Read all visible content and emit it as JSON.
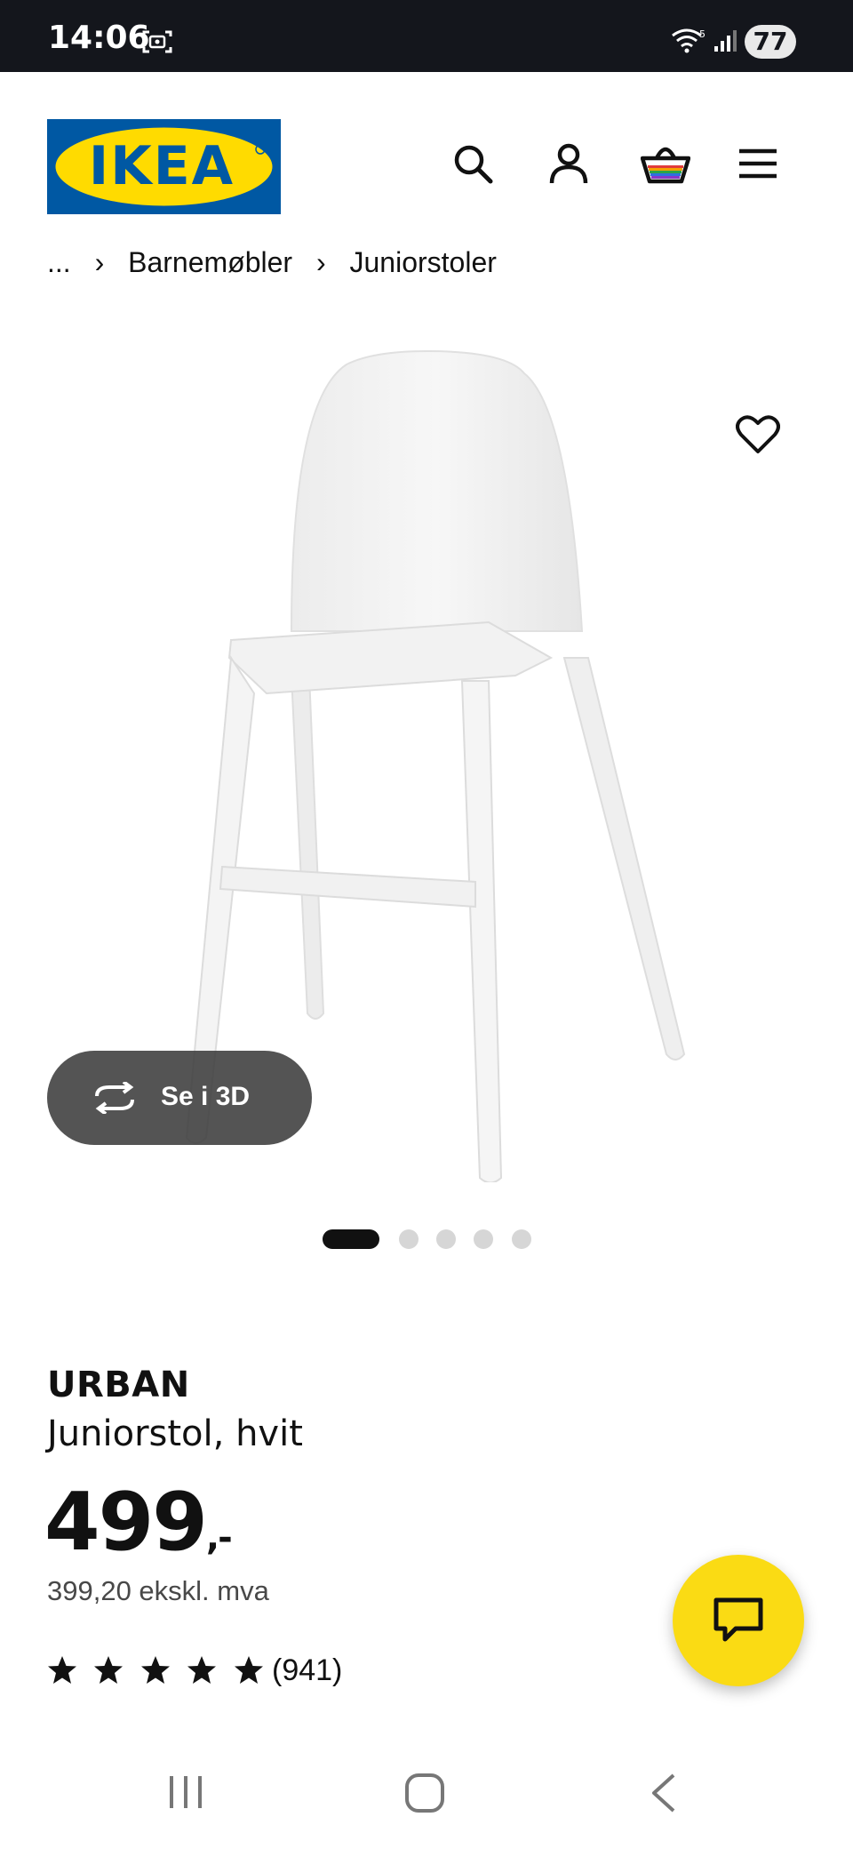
{
  "status_bar": {
    "time": "14:06",
    "battery": "77",
    "icons": [
      "screen-capture-icon",
      "wifi-icon",
      "signal-icon",
      "battery-icon"
    ]
  },
  "header": {
    "logo_text": "IKEA",
    "logo_colors": {
      "background": "#0058a3",
      "oval": "#ffdb00",
      "text": "#0058a3"
    },
    "icons": [
      "search-icon",
      "account-icon",
      "cart-icon",
      "menu-icon"
    ]
  },
  "breadcrumb": {
    "ellipsis": "...",
    "items": [
      "Barnemøbler",
      "Juniorstoler"
    ],
    "separator": "›"
  },
  "gallery": {
    "view_3d_label": "Se i 3D",
    "slide_count": 5,
    "active_index": 0
  },
  "product": {
    "name": "URBAN",
    "description": "Juniorstol, hvit",
    "price": "499",
    "price_suffix": ",-",
    "price_ex_vat": "399,20 ekskl. mva",
    "rating_stars": 5,
    "review_count": "(941)"
  },
  "colors": {
    "accent_yellow": "#fadb14",
    "dark_text": "#111111",
    "status_bar": "#14161c"
  }
}
